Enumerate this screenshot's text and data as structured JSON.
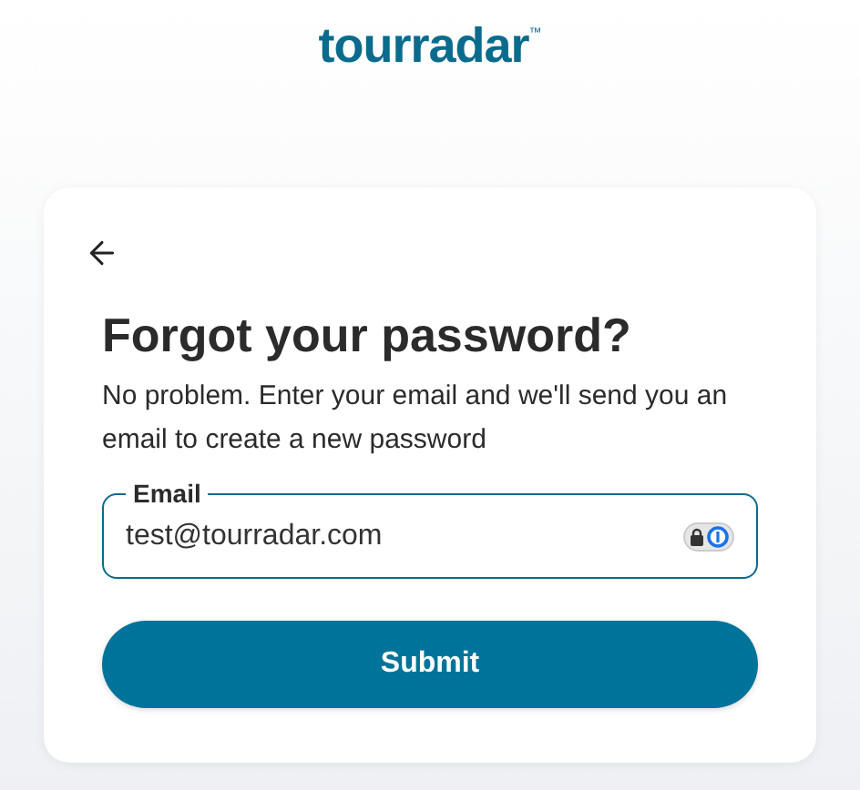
{
  "logo": {
    "text": "tourradar",
    "mark": "™"
  },
  "card": {
    "title": "Forgot your password?",
    "description": "No problem. Enter your email and we'll send you an email to create a new password",
    "email_field": {
      "label": "Email",
      "value": "test@tourradar.com"
    },
    "submit": "Submit"
  }
}
